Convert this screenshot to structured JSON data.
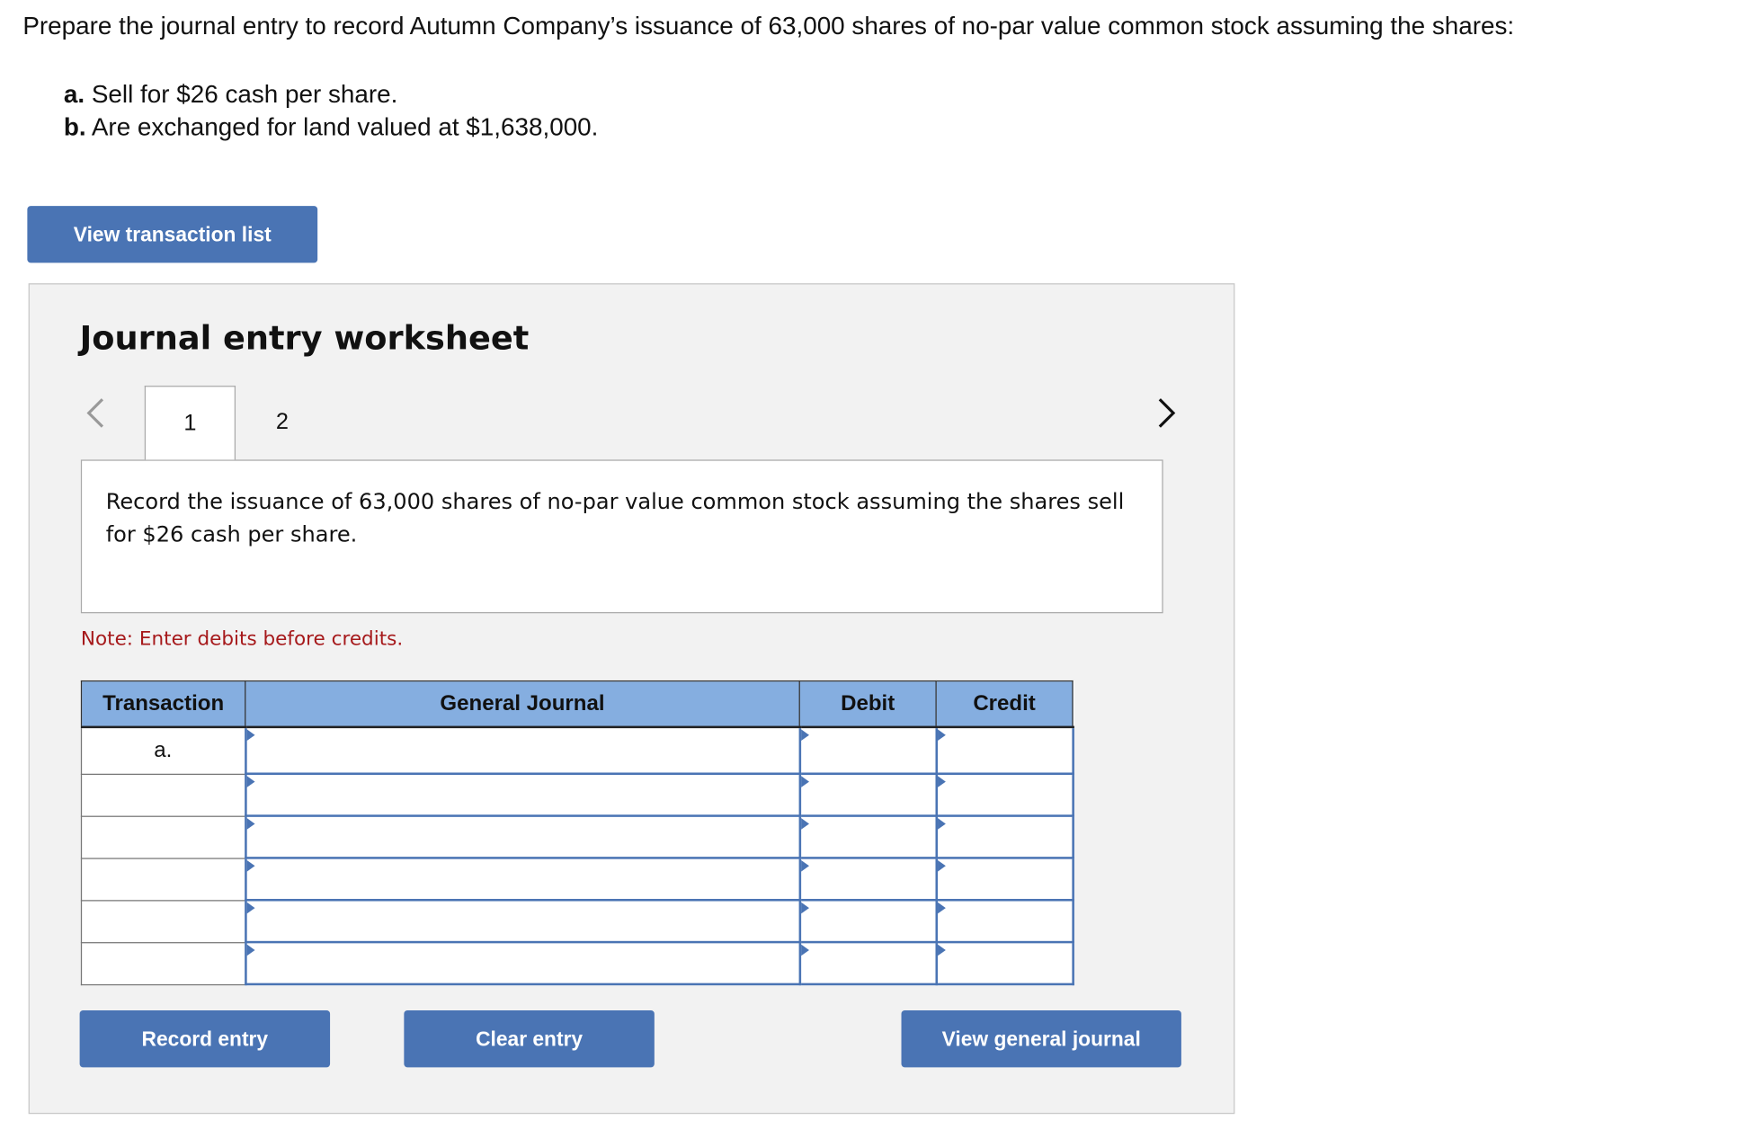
{
  "question": "Prepare the journal entry to record Autumn Company’s issuance of 63,000 shares of no-par value common stock assuming the shares:",
  "parts": [
    {
      "label": "a.",
      "text": " Sell for $26 cash per share."
    },
    {
      "label": "b.",
      "text": " Are exchanged for land valued at $1,638,000."
    }
  ],
  "view_transaction_list": "View transaction list",
  "worksheet": {
    "title": "Journal entry worksheet",
    "tabs": [
      "1",
      "2"
    ],
    "instruction": "Record the issuance of 63,000 shares of no-par value common stock assuming the shares sell for $26 cash per share.",
    "note": "Note: Enter debits before credits.",
    "columns": [
      "Transaction",
      "General Journal",
      "Debit",
      "Credit"
    ],
    "rows": [
      {
        "transaction": "a."
      },
      {
        "transaction": ""
      },
      {
        "transaction": ""
      },
      {
        "transaction": ""
      },
      {
        "transaction": ""
      },
      {
        "transaction": ""
      }
    ],
    "buttons": {
      "record": "Record entry",
      "clear": "Clear entry",
      "view_journal": "View general journal"
    }
  },
  "colors": {
    "button": "#4a74b4",
    "header": "#85aee0",
    "note": "#a6191b"
  }
}
